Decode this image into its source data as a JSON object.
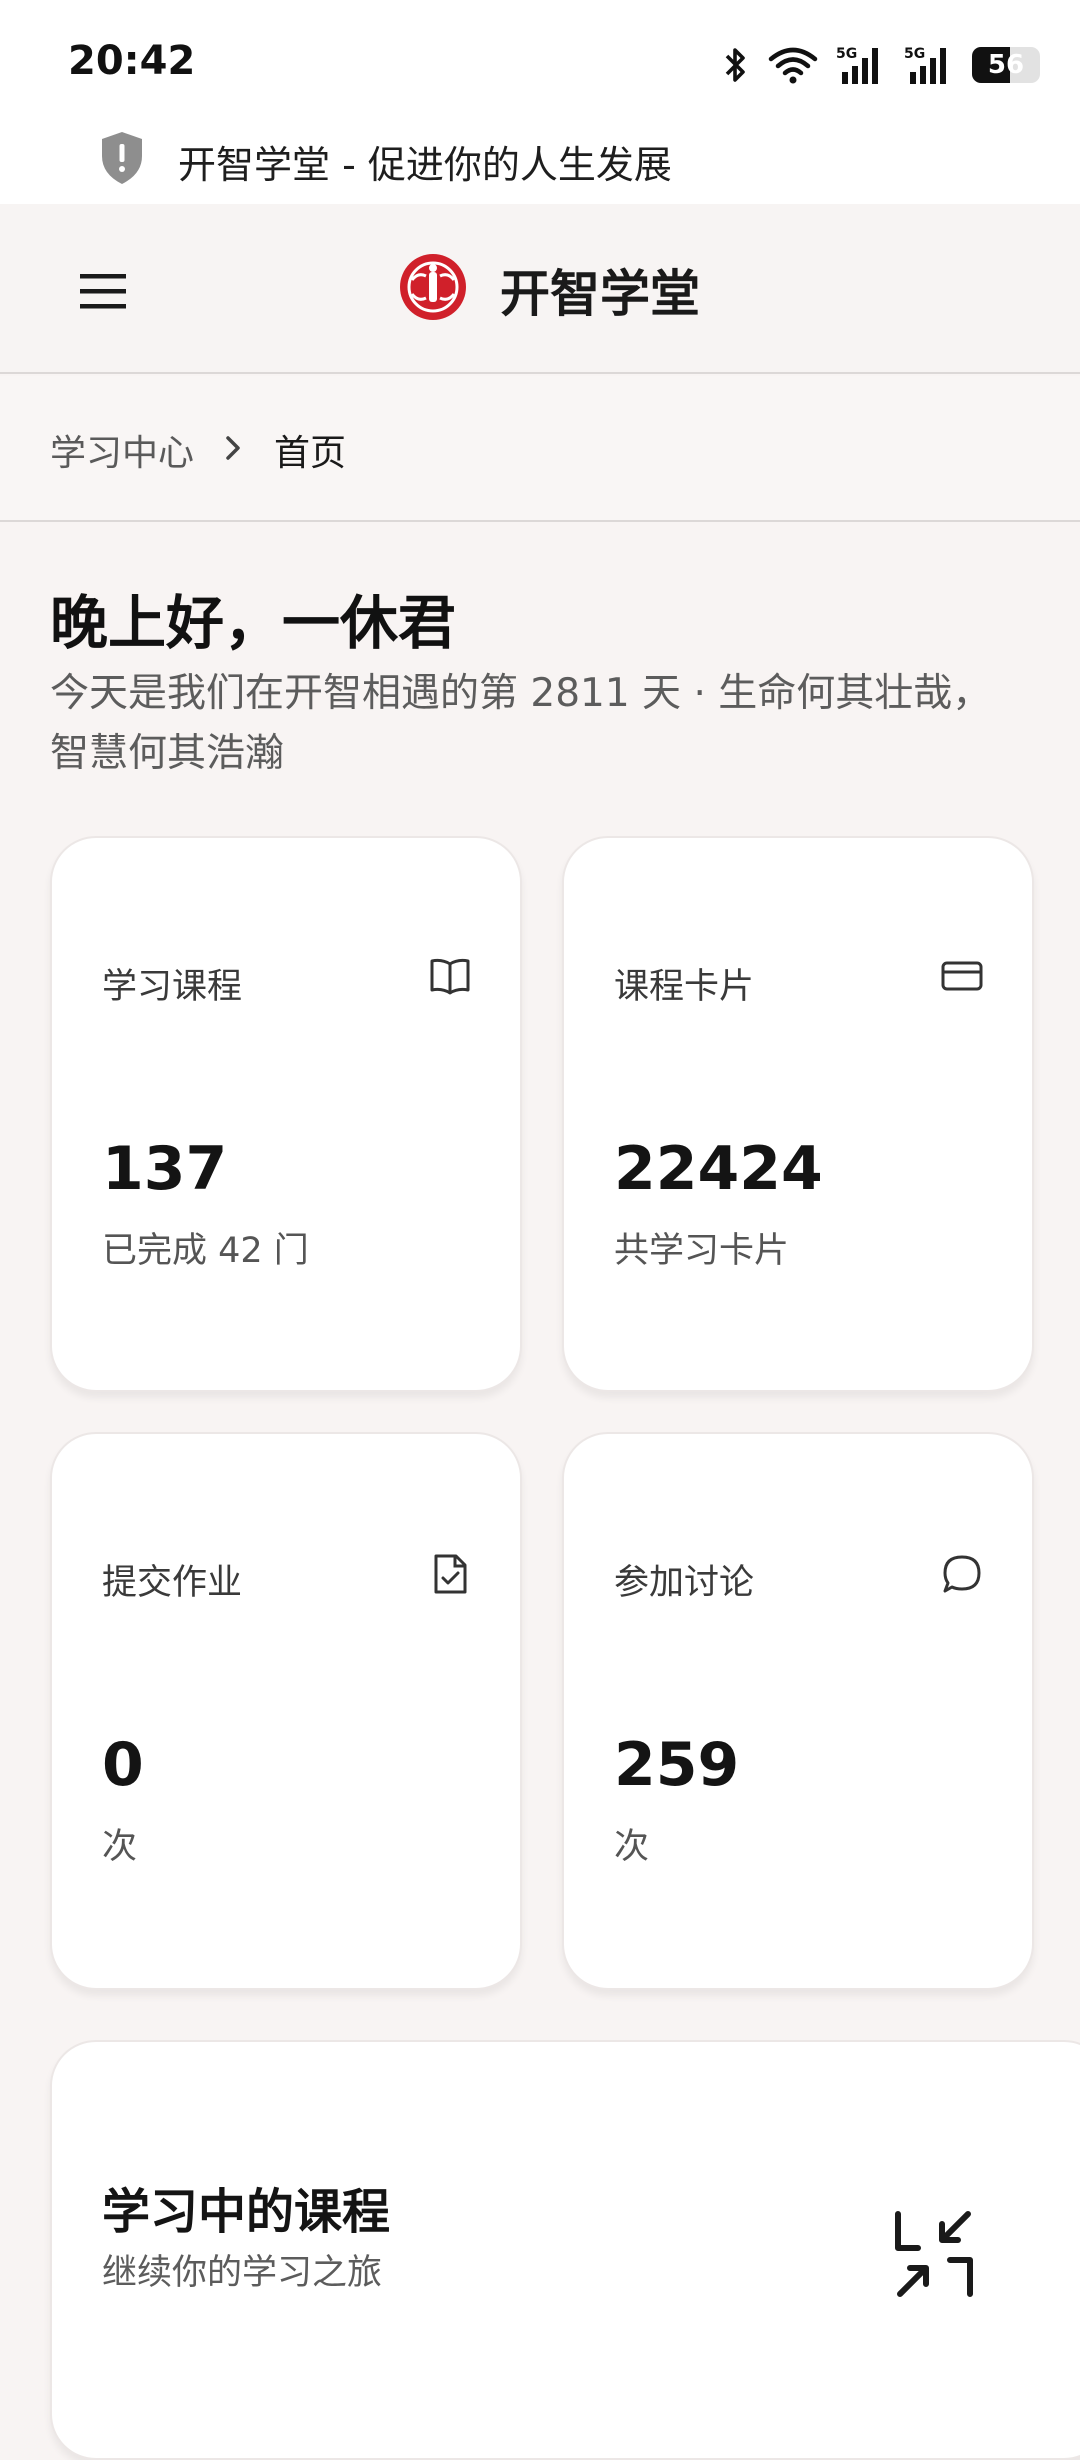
{
  "status_bar": {
    "time": "20:42",
    "battery": "56",
    "battery_level_percent": 56,
    "icons": [
      "bluetooth-icon",
      "wifi-icon",
      "5g-signal-icon",
      "5g-signal-icon",
      "battery-icon"
    ]
  },
  "browser": {
    "page_title": "开智学堂 - 促进你的人生发展",
    "icon": "shield-icon"
  },
  "header": {
    "app_title": "开智学堂",
    "menu_icon": "hamburger-menu-icon",
    "logo_icon": "kaizhi-logo"
  },
  "breadcrumb": {
    "items": [
      "学习中心",
      "首页"
    ],
    "separator_icon": "chevron-right-icon"
  },
  "greeting": {
    "title": "晚上好，一休君",
    "subtitle": "今天是我们在开智相遇的第 2811 天 · 生命何其壮哉，智慧何其浩瀚"
  },
  "stats": [
    {
      "label": "学习课程",
      "value": "137",
      "sub": "已完成 42 门",
      "icon": "book-icon"
    },
    {
      "label": "课程卡片",
      "value": "22424",
      "sub": "共学习卡片",
      "icon": "card-icon"
    },
    {
      "label": "提交作业",
      "value": "0",
      "sub": "次",
      "icon": "file-check-icon"
    },
    {
      "label": "参加讨论",
      "value": "259",
      "sub": "次",
      "icon": "chat-bubble-icon"
    }
  ],
  "courses_section": {
    "title": "学习中的课程",
    "subtitle": "继续你的学习之旅",
    "action_icon": "collapse-arrows-icon"
  },
  "colors": {
    "background": "#f8f4f3",
    "card": "#ffffff",
    "logo_red": "#d0202a",
    "text_primary": "#141414",
    "text_secondary": "#5c5c5c"
  }
}
